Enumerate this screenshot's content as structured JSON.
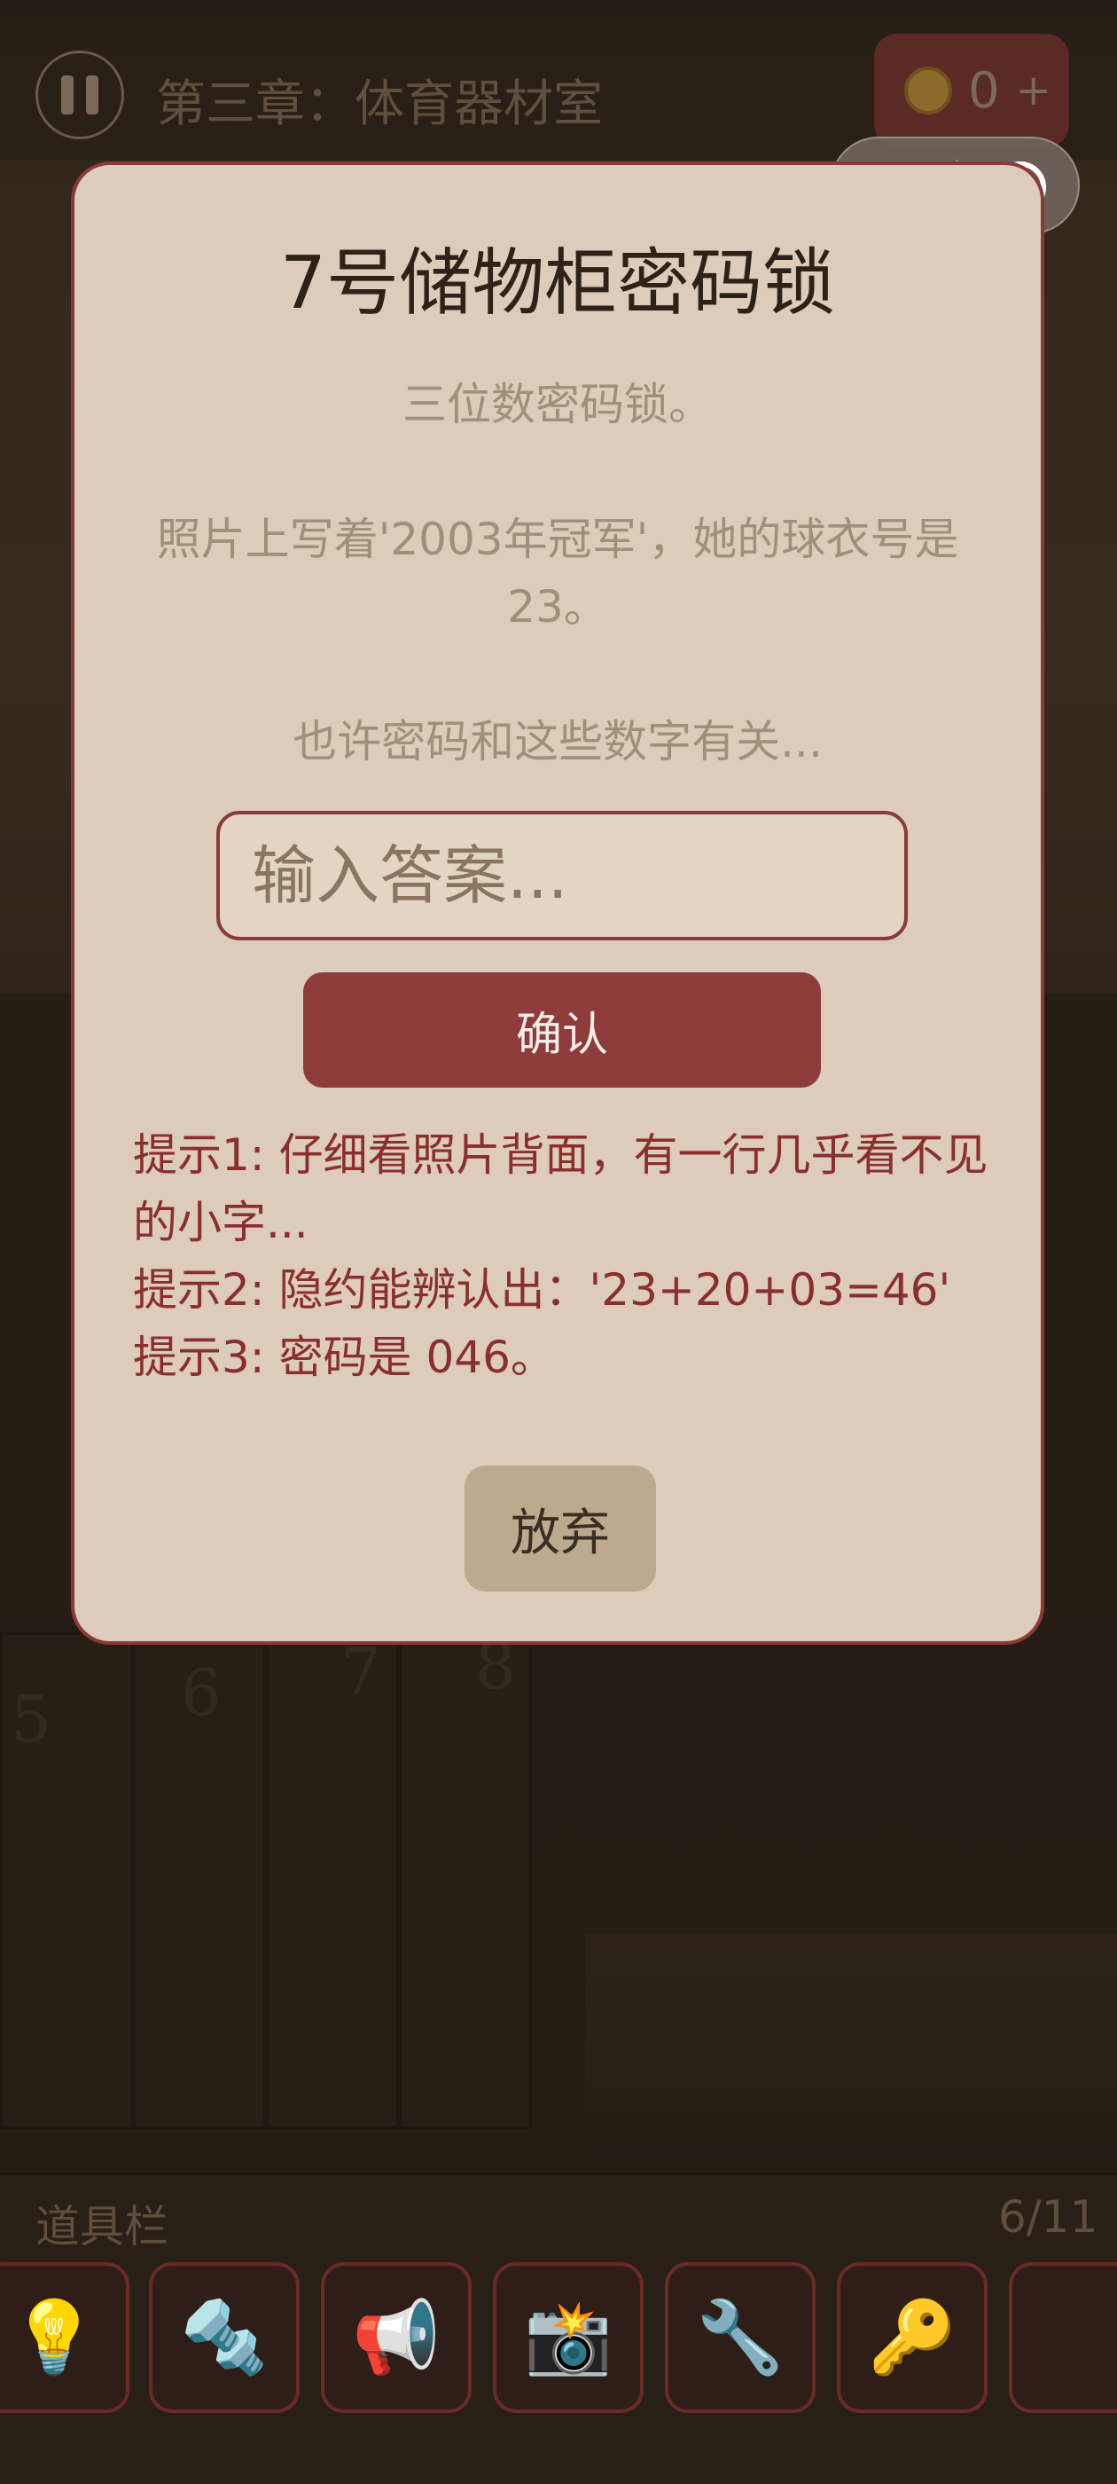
{
  "topbar": {
    "chapter_title": "第三章：体育器材室",
    "coins": "0",
    "coin_plus": "+"
  },
  "scene": {
    "locker_numbers": [
      "5",
      "6",
      "7",
      "8"
    ]
  },
  "modal": {
    "title": "7号储物柜密码锁",
    "description": "三位数密码锁。\n\n照片上写着'2003年冠军'，她的球衣号是23。\n\n也许密码和这些数字有关...",
    "input_placeholder": "输入答案...",
    "confirm_label": "确认",
    "hints": [
      "提示1: 仔细看照片背面，有一行几乎看不见的小字...",
      "提示2: 隐约能辨认出：'23+20+03=46'",
      "提示3: 密码是 046。"
    ],
    "giveup_label": "放弃"
  },
  "inventory": {
    "title": "道具栏",
    "count": "6/11",
    "items": [
      {
        "name": "lightbulb",
        "glyph": "💡"
      },
      {
        "name": "bolt",
        "glyph": "🔩"
      },
      {
        "name": "megaphone",
        "glyph": "📢"
      },
      {
        "name": "camera",
        "glyph": "📸"
      },
      {
        "name": "wrench",
        "glyph": "🔧"
      },
      {
        "name": "key",
        "glyph": "🔑"
      },
      {
        "name": "empty",
        "glyph": ""
      }
    ]
  },
  "colors": {
    "accent": "#8e3b3c",
    "modal_bg": "#dcccb9",
    "hint_text": "#8a2e2e"
  }
}
